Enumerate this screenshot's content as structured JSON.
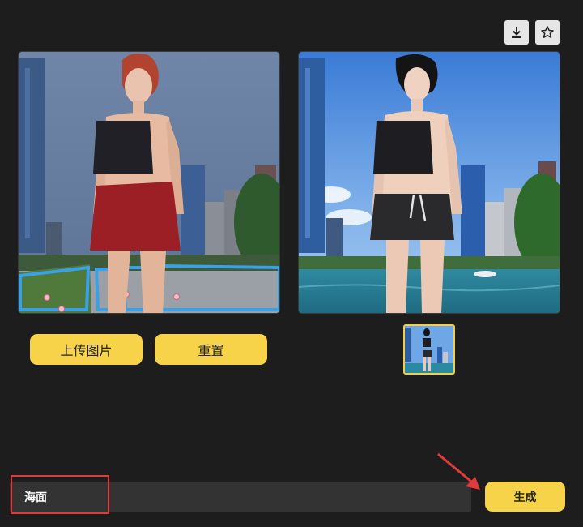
{
  "toolbar": {
    "download_icon": "download-icon",
    "star_icon": "star-icon"
  },
  "left_panel": {
    "label": "original-image-with-mask"
  },
  "right_panel": {
    "label": "generated-result-image"
  },
  "buttons": {
    "upload_label": "上传图片",
    "reset_label": "重置",
    "generate_label": "生成"
  },
  "prompt": {
    "value": "海面"
  },
  "colors": {
    "background": "#1d1d1e",
    "accent": "#f7d34a",
    "highlight": "#e23a3a",
    "mask_outline": "#3aa0e8"
  }
}
